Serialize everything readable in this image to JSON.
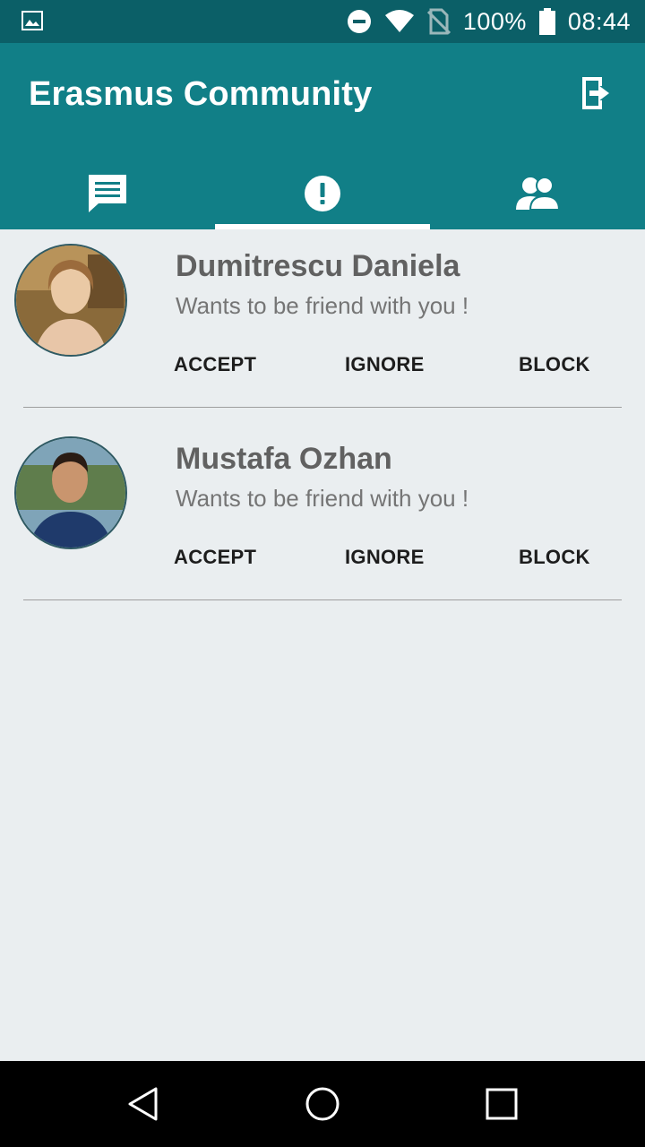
{
  "status_bar": {
    "battery_text": "100%",
    "time": "08:44",
    "icons": [
      "image-icon",
      "do-not-disturb-icon",
      "wifi-icon",
      "no-sim-icon",
      "battery-icon"
    ]
  },
  "app": {
    "title": "Erasmus Community",
    "accent": "#117f87",
    "status_color": "#0b5f67"
  },
  "tabs": [
    {
      "icon": "chat-icon",
      "active": false
    },
    {
      "icon": "alert-icon",
      "active": true
    },
    {
      "icon": "people-icon",
      "active": false
    }
  ],
  "requests": [
    {
      "name": "Dumitrescu Daniela",
      "message": "Wants to be friend with you !",
      "accept": "ACCEPT",
      "ignore": "IGNORE",
      "block": "BLOCK"
    },
    {
      "name": "Mustafa Ozhan",
      "message": "Wants to be friend with you !",
      "accept": "ACCEPT",
      "ignore": "IGNORE",
      "block": "BLOCK"
    }
  ],
  "nav": {
    "icons": [
      "back-icon",
      "home-icon",
      "recents-icon"
    ]
  }
}
